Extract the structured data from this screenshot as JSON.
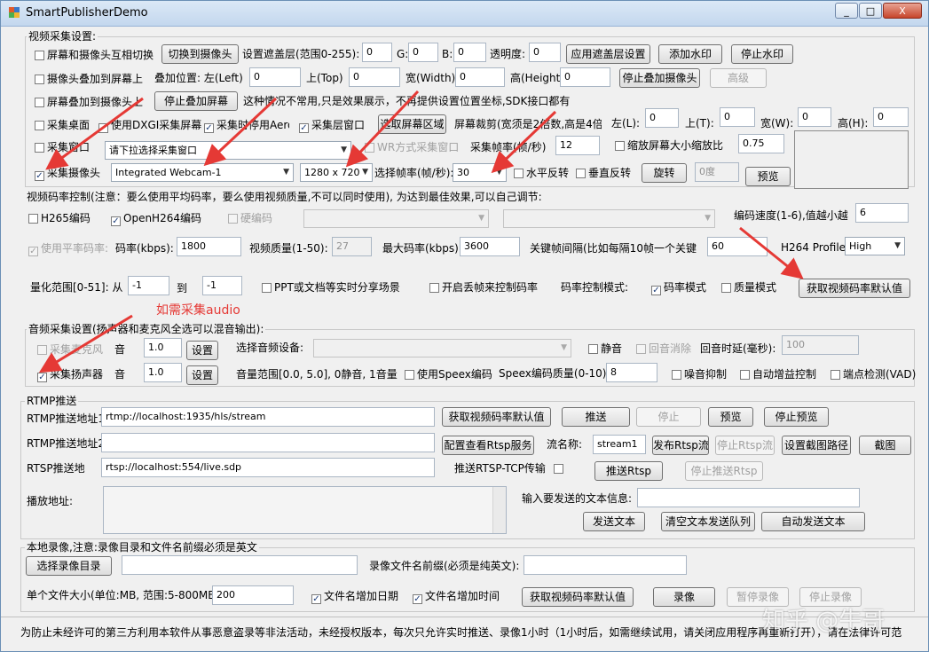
{
  "window": {
    "title": "SmartPublisherDemo",
    "min": "_",
    "max": "□",
    "close": "X"
  },
  "video_capture": {
    "group_title": "视频采集设置:",
    "row1": {
      "screen_cam_switch": "屏幕和摄像头互相切换",
      "switch_to_cam_btn": "切换到摄像头",
      "mask_label": "设置遮盖层(范围0-255): R:",
      "r": "0",
      "g_label": "G:",
      "g": "0",
      "b_label": "B:",
      "b": "0",
      "alpha_label": "透明度:",
      "alpha": "0",
      "apply_mask_btn": "应用遮盖层设置",
      "add_watermark_btn": "添加水印",
      "stop_watermark_btn": "停止水印"
    },
    "row2": {
      "cam_overlay_screen": "摄像头叠加到屏幕上",
      "overlay_pos_label": "叠加位置: 左(Left)",
      "left": "0",
      "top_label": "上(Top)",
      "top": "0",
      "width_label": "宽(Width)",
      "width": "0",
      "height_label": "高(Height)",
      "height": "0",
      "stop_overlay_cam_btn": "停止叠加摄像头",
      "advanced_btn": "高级"
    },
    "row3": {
      "screen_overlay_cam": "屏幕叠加到摄像头上",
      "stop_overlay_screen_btn": "停止叠加屏幕",
      "note": "这种情况不常用,只是效果展示，不再提供设置位置坐标,SDK接口都有"
    },
    "row4": {
      "capture_desktop": "采集桌面",
      "use_dxgi": "使用DXGI采集屏幕",
      "disable_aero": "采集时停用Aero",
      "capture_layer_window": "采集层窗口",
      "select_region_btn": "选取屏幕区域",
      "crop_label": "屏幕裁剪(宽须是2倍数,高是4倍",
      "crop_left_label": "左(L):",
      "crop_left": "0",
      "crop_top_label": "上(T):",
      "crop_top": "0",
      "crop_width_label": "宽(W):",
      "crop_width": "0",
      "crop_height_label": "高(H):",
      "crop_height": "0"
    },
    "row5": {
      "capture_window": "采集窗口",
      "window_select": "请下拉选择采集窗口",
      "wr_capture": "WR方式采集窗口",
      "framerate_label": "采集帧率(帧/秒)",
      "framerate": "12",
      "scale_screen": "缩放屏幕大小缩放比",
      "scale": "0.75"
    },
    "row6": {
      "capture_camera": "采集摄像头",
      "camera_select": "Integrated Webcam-1",
      "resolution_select": "1280 x 720",
      "cam_framerate_label": "选择帧率(帧/秒):",
      "cam_framerate": "30",
      "hflip": "水平反转",
      "vflip": "垂直反转",
      "rotate_btn": "旋转",
      "rotate_value": "0度",
      "preview_btn": "预览"
    }
  },
  "bitrate": {
    "group_title": "视频码率控制(注意：要么使用平均码率，要么使用视频质量,不可以同时使用), 为达到最佳效果,可以自己调节:",
    "h265": "H265编码",
    "openh264": "OpenH264编码",
    "hw_encode": "硬编码",
    "speed_label": "编码速度(1-6),值越小越",
    "speed": "6",
    "avg_bitrate": "使用平率码率:",
    "bitrate_label": "码率(kbps):",
    "bitrate": "1800",
    "quality_label": "视频质量(1-50):",
    "quality": "27",
    "max_bitrate_label": "最大码率(kbps):",
    "max_bitrate": "3600",
    "keyframe_label": "关键帧间隔(比如每隔10帧一个关键",
    "keyframe": "60",
    "profile_label": "H264 Profile:",
    "profile": "High",
    "qp_label": "量化范围[0-51]: 从",
    "qp_from": "-1",
    "qp_to_label": "到",
    "qp_to": "-1",
    "ppt_share": "PPT或文档等实时分享场景",
    "frame_drop": "开启丢帧来控制码率",
    "mode_label": "码率控制模式:",
    "bitrate_mode": "码率模式",
    "quality_mode": "质量模式",
    "get_default_btn": "获取视频码率默认值"
  },
  "annotations": {
    "audio_hint": "如需采集audio",
    "watermark": "知乎 @牛哥"
  },
  "audio": {
    "group_title": "音频采集设置(扬声器和麦克风全选可以混音输出):",
    "mic": "采集麦克风",
    "mic_vol_label": "音",
    "mic_vol": "1.0",
    "mic_set_btn": "设置",
    "device_label": "选择音频设备:",
    "mute": "静音",
    "echo_cancel": "回音消除",
    "echo_delay_label": "回音时延(毫秒):",
    "echo_delay": "100",
    "speaker": "采集扬声器",
    "spk_vol_label": "音",
    "spk_vol": "1.0",
    "spk_set_btn": "设置",
    "range_note": "音量范围[0.0, 5.0], 0静音, 1音量",
    "speex": "使用Speex编码",
    "speex_quality_label": "Speex编码质量(0-10):",
    "speex_quality": "8",
    "noise_suppress": "噪音抑制",
    "agc": "自动增益控制",
    "vad": "端点检测(VAD)"
  },
  "rtmp": {
    "group_title": "RTMP推送",
    "url1_label": "RTMP推送地址1:",
    "url1": "rtmp://localhost:1935/hls/stream",
    "get_default_btn": "获取视频码率默认值",
    "push_btn": "推送",
    "stop_btn": "停止",
    "preview_btn": "预览",
    "stop_preview_btn": "停止预览",
    "url2_label": "RTMP推送地址2:",
    "url2": "",
    "rtsp_config_btn": "配置查看Rtsp服务",
    "stream_name_label": "流名称:",
    "stream_name": "stream1",
    "publish_rtsp_btn": "发布Rtsp流",
    "stop_rtsp_stream_btn": "停止Rtsp流",
    "snapshot_path_btn": "设置截图路径",
    "snapshot_btn": "截图",
    "rtsp_label": "RTSP推送地",
    "rtsp_url": "rtsp://localhost:554/live.sdp",
    "rtsp_tcp_label": "推送RTSP-TCP传输",
    "push_rtsp_btn": "推送Rtsp",
    "stop_push_rtsp_btn": "停止推送Rtsp",
    "play_url_label": "播放地址:",
    "text_input_label": "输入要发送的文本信息:",
    "send_text_btn": "发送文本",
    "clear_queue_btn": "清空文本发送队列",
    "auto_send_btn": "自动发送文本"
  },
  "record": {
    "group_title": "本地录像,注意:录像目录和文件名前缀必须是英文",
    "choose_dir_btn": "选择录像目录",
    "dir": "",
    "prefix_label": "录像文件名前缀(必须是纯英文):",
    "prefix": "",
    "size_label": "单个文件大小(单位:MB, 范围:5-800MB):",
    "size": "200",
    "append_date": "文件名增加日期",
    "append_time": "文件名增加时间",
    "get_default_btn": "获取视频码率默认值",
    "record_btn": "录像",
    "pause_btn": "暂停录像",
    "stop_btn": "停止录像"
  },
  "status_text": "为防止未经许可的第三方利用本软件从事恶意盗录等非法活动，未经授权版本，每次只允许实时推送、录像1小时（1小时后，如需继续试用，请关闭应用程序再重新打开），请在法律许可范",
  "colors": {
    "arrow": "#e53935",
    "title_grad": "#c3d7ee",
    "bg": "#f0f0f0"
  }
}
